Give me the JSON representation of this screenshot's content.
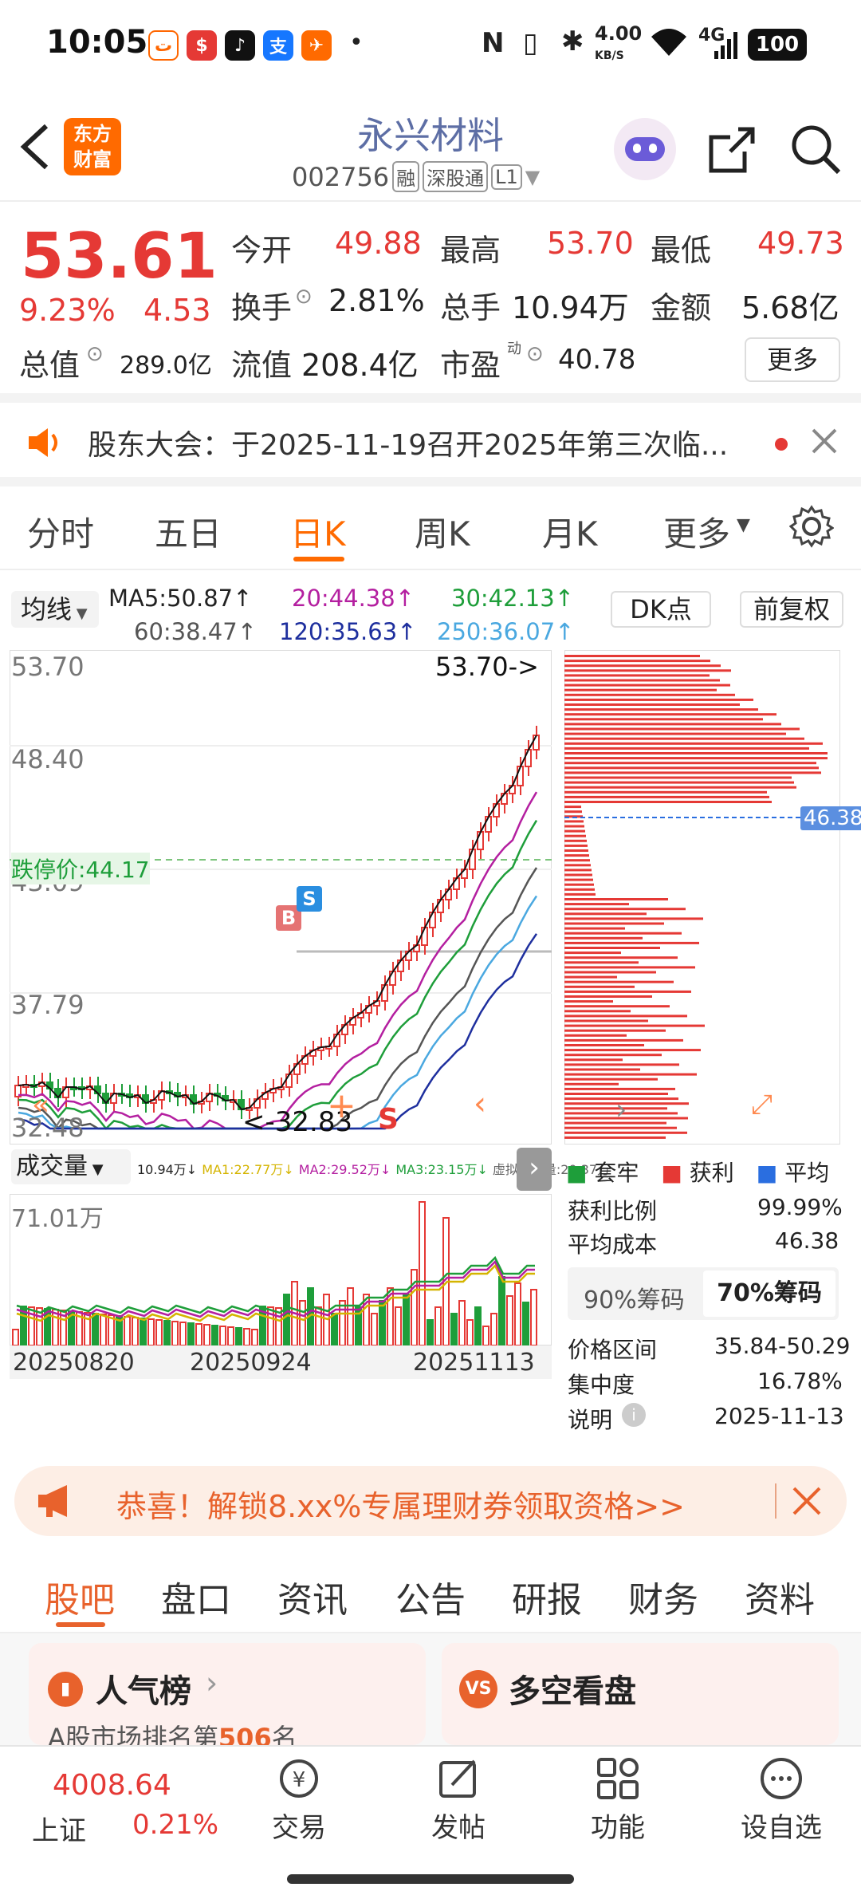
{
  "status_bar": {
    "time": "10:05",
    "net_speed": "4.00",
    "net_unit": "KB/S",
    "signal": "4G",
    "battery": "100",
    "icons": [
      "taobao-icon",
      "bank-icon",
      "tiktok-icon",
      "alipay-icon",
      "feishu-icon"
    ]
  },
  "header": {
    "stock_name": "永兴材料",
    "stock_code": "002756",
    "tags": [
      "融",
      "深股通",
      "L1"
    ],
    "logo_line1": "东方",
    "logo_line2": "财富"
  },
  "quote": {
    "price": "53.61",
    "change_pct": "9.23%",
    "change_amt": "4.53",
    "open_label": "今开",
    "open": "49.88",
    "high_label": "最高",
    "high": "53.70",
    "low_label": "最低",
    "low": "49.73",
    "turnover_label": "换手",
    "turnover": "2.81%",
    "volume_label": "总手",
    "volume": "10.94万",
    "amount_label": "金额",
    "amount": "5.68亿",
    "mktcap_label": "总值",
    "mktcap": "289.0亿",
    "float_label": "流值",
    "float_cap": "208.4亿",
    "pe_label": "市盈",
    "pe_sup": "动",
    "pe": "40.78",
    "more_button": "更多"
  },
  "notice": {
    "text": "股东大会：于2025-11-19召开2025年第三次临..."
  },
  "chart_tabs": [
    "分时",
    "五日",
    "日K",
    "周K",
    "月K",
    "更多"
  ],
  "active_tab": "日K",
  "ma": {
    "selector": "均线",
    "ma5": "MA5:50.87↑",
    "ma20": "20:44.38↑",
    "ma30": "30:42.13↑",
    "ma60": "60:38.47↑",
    "ma120": "120:35.63↑",
    "ma250": "250:36.07↑",
    "dk_button": "DK点",
    "adjust_button": "前复权"
  },
  "kline": {
    "y_labels": [
      "53.70",
      "48.40",
      "43.09",
      "37.79",
      "32.48"
    ],
    "max_marker": "53.70->",
    "min_marker": "<-32.83",
    "limit_down": "跌停价:44.17",
    "b_marker": "B",
    "s_marker": "S",
    "s_bottom": "S"
  },
  "chips": {
    "avg_cost_tag": "46.38"
  },
  "volume": {
    "selector": "成交量",
    "legend": [
      "10.94万↓",
      "MA1:22.77万↓",
      "MA2:29.52万↓",
      "MA3:23.15万↓",
      "虚拟成交量:20.37万"
    ],
    "max_label": "71.01万",
    "dates": [
      "20250820",
      "20250924",
      "20251113"
    ]
  },
  "chip_stats": {
    "legend": [
      "套牢",
      "获利",
      "平均"
    ],
    "profit_ratio_label": "获利比例",
    "profit_ratio": "99.99%",
    "avg_cost_label": "平均成本",
    "avg_cost": "46.38",
    "tab90": "90%筹码",
    "tab70": "70%筹码",
    "range_label": "价格区间",
    "range": "35.84-50.29",
    "concentration_label": "集中度",
    "concentration": "16.78%",
    "note_label": "说明",
    "note_date": "2025-11-13"
  },
  "banner": {
    "text": "恭喜！解锁8.xx%专属理财券领取资格>>"
  },
  "bottom_tabs": [
    "股吧",
    "盘口",
    "资讯",
    "公告",
    "研报",
    "财务",
    "资料"
  ],
  "cards": {
    "popular": "人气榜",
    "popular_sub": "A股市场排名第",
    "rank": "506",
    "rank_suffix": "名",
    "bullbear": "多空看盘"
  },
  "bottom_nav": {
    "index_value": "4008.64",
    "index_name": "上证",
    "index_change": "0.21%",
    "items": [
      "交易",
      "发帖",
      "功能",
      "设自选"
    ]
  },
  "colors": {
    "up": "#e53935",
    "down": "#1e9e3a",
    "accent": "#ff6a00"
  }
}
